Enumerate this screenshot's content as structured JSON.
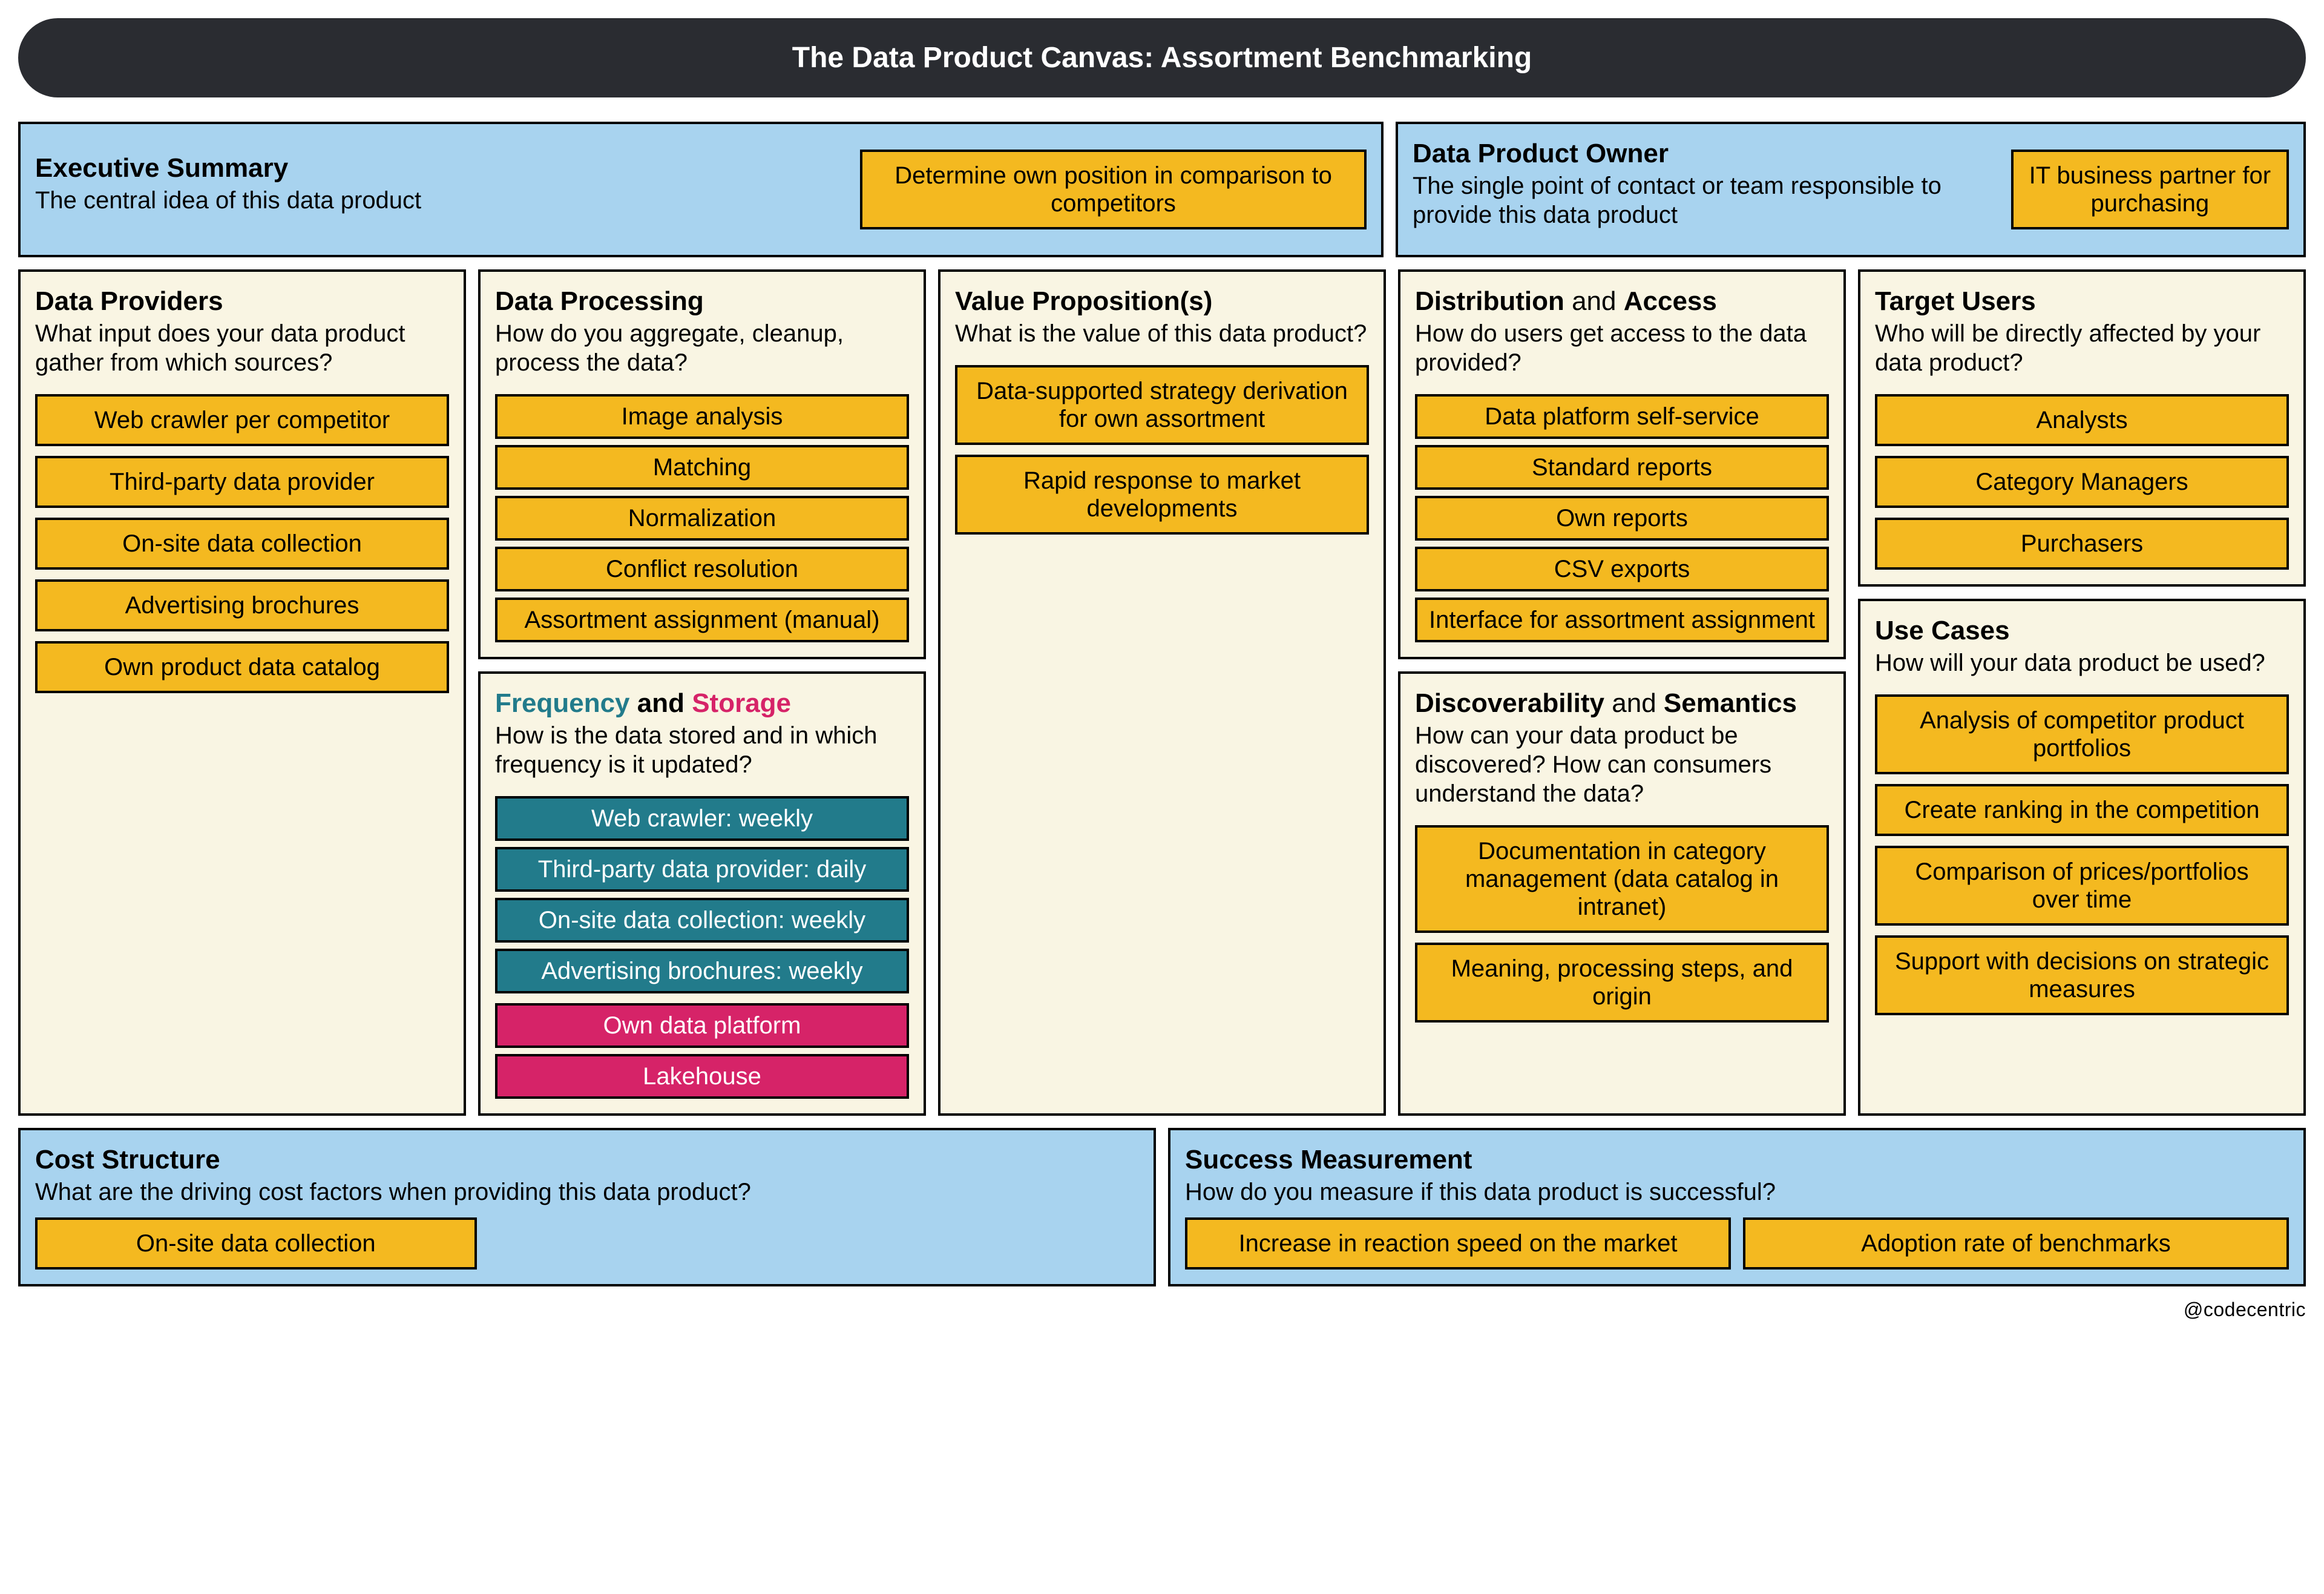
{
  "title": "The Data Product Canvas: Assortment Benchmarking",
  "brand": "@codecentric",
  "exec": {
    "heading": "Executive Summary",
    "sub": "The central idea of this data product",
    "chip": "Determine own position in comparison to competitors"
  },
  "owner": {
    "heading": "Data Product Owner",
    "sub": "The single point of contact or team responsible to provide this data product",
    "chip": "IT business partner for purchasing"
  },
  "providers": {
    "heading": "Data Providers",
    "sub": "What input does your data product gather from which sources?",
    "items": [
      "Web crawler per competitor",
      "Third-party data provider",
      "On-site data collection",
      "Advertising brochures",
      "Own product data catalog"
    ]
  },
  "processing": {
    "heading": "Data Processing",
    "sub": "How do you aggregate, cleanup, process the data?",
    "items": [
      "Image analysis",
      "Matching",
      "Normalization",
      "Conflict resolution",
      "Assortment assignment (manual)"
    ]
  },
  "freqstorage": {
    "head_a": "Frequency",
    "head_join": " and ",
    "head_b": "Storage",
    "sub": "How is the data stored and in which frequency is it updated?",
    "freq_items": [
      "Web crawler: weekly",
      "Third-party data provider: daily",
      "On-site data collection: weekly",
      "Advertising brochures: weekly"
    ],
    "storage_items": [
      "Own data platform",
      "Lakehouse"
    ]
  },
  "value": {
    "heading": "Value Proposition(s)",
    "sub": "What is the value of this data product?",
    "items": [
      "Data-supported strategy derivation for own assortment",
      "Rapid response to market developments"
    ]
  },
  "distribution": {
    "head_a": "Distribution",
    "head_join": " and ",
    "head_b": "Access",
    "sub": "How do users get access to the data provided?",
    "items": [
      "Data platform self-service",
      "Standard reports",
      "Own reports",
      "CSV exports",
      "Interface for assortment assignment"
    ]
  },
  "discover": {
    "head_a": "Discoverability",
    "head_join": " and ",
    "head_b": "Semantics",
    "sub": "How can your data product be discovered? How can consumers understand the data?",
    "items": [
      "Documentation in category management (data catalog in intranet)",
      "Meaning, processing steps, and origin"
    ]
  },
  "users": {
    "heading": "Target Users",
    "sub": "Who will be directly affected by your data product?",
    "items": [
      "Analysts",
      "Category Managers",
      "Purchasers"
    ]
  },
  "usecases": {
    "heading": "Use Cases",
    "sub": "How will your data product be used?",
    "items": [
      "Analysis of competitor product portfolios",
      "Create ranking in the competition",
      "Comparison of prices/portfolios over time",
      "Support with decisions on strategic measures"
    ]
  },
  "cost": {
    "heading": "Cost Structure",
    "sub": "What are the driving cost factors when providing this data product?",
    "items": [
      "On-site data collection"
    ]
  },
  "success": {
    "heading": "Success Measurement",
    "sub": "How do you measure if this data product is successful?",
    "items": [
      "Increase in reaction speed on the market",
      "Adoption rate of benchmarks"
    ]
  }
}
